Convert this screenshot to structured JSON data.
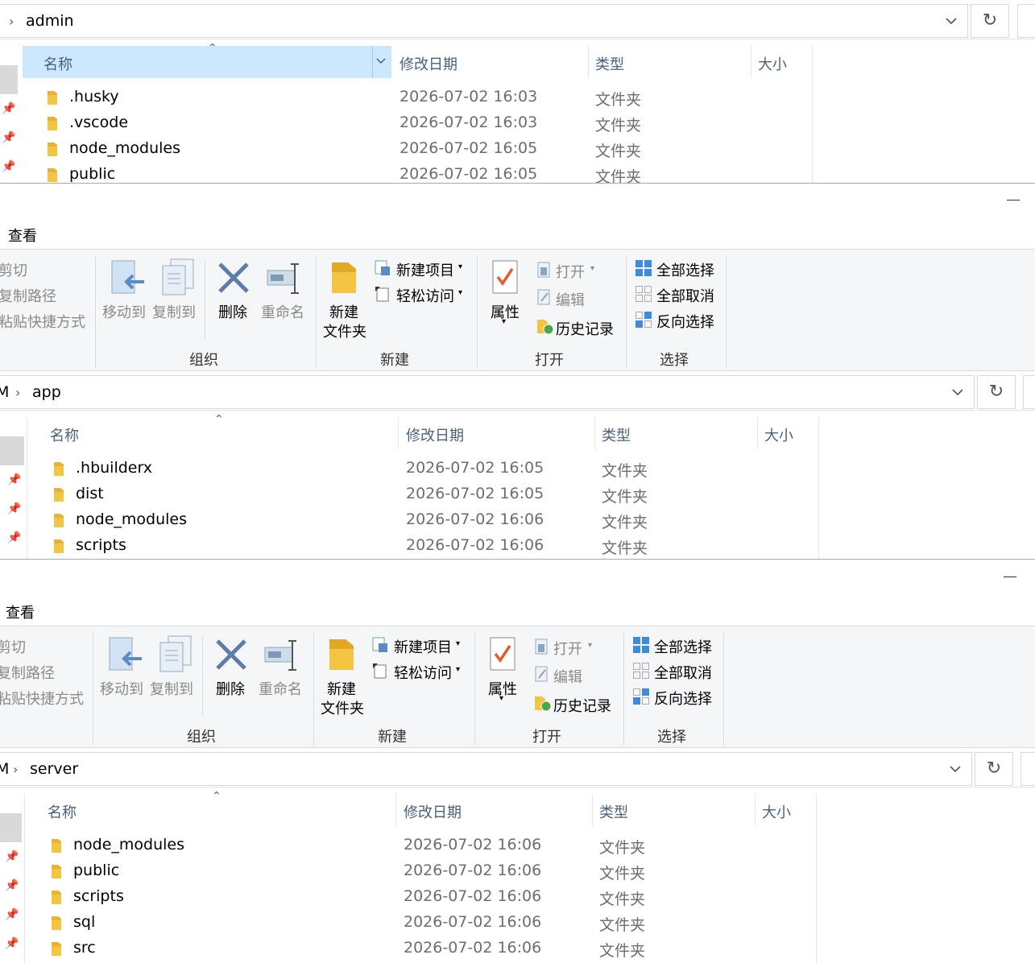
{
  "windows": [
    {
      "path_label": "admin",
      "columns": {
        "name": "名称",
        "modified": "修改日期",
        "type": "类型",
        "size": "大小"
      },
      "rows": [
        {
          "name": ".husky",
          "modified": "2026-07-02 16:03",
          "type": "文件夹"
        },
        {
          "name": ".vscode",
          "modified": "2026-07-02 16:03",
          "type": "文件夹"
        },
        {
          "name": "node_modules",
          "modified": "2026-07-02 16:05",
          "type": "文件夹"
        },
        {
          "name": "public",
          "modified": "2026-07-02 16:05",
          "type": "文件夹"
        }
      ]
    },
    {
      "path_prefix": "M",
      "path_label": "app",
      "columns": {
        "name": "名称",
        "modified": "修改日期",
        "type": "类型",
        "size": "大小"
      },
      "rows": [
        {
          "name": ".hbuilderx",
          "modified": "2026-07-02 16:05",
          "type": "文件夹"
        },
        {
          "name": "dist",
          "modified": "2026-07-02 16:05",
          "type": "文件夹"
        },
        {
          "name": "node_modules",
          "modified": "2026-07-02 16:06",
          "type": "文件夹"
        },
        {
          "name": "scripts",
          "modified": "2026-07-02 16:06",
          "type": "文件夹"
        }
      ]
    },
    {
      "path_prefix": "M",
      "path_label": "server",
      "columns": {
        "name": "名称",
        "modified": "修改日期",
        "type": "类型",
        "size": "大小"
      },
      "rows": [
        {
          "name": "node_modules",
          "modified": "2026-07-02 16:06",
          "type": "文件夹"
        },
        {
          "name": "public",
          "modified": "2026-07-02 16:06",
          "type": "文件夹"
        },
        {
          "name": "scripts",
          "modified": "2026-07-02 16:06",
          "type": "文件夹"
        },
        {
          "name": "sql",
          "modified": "2026-07-02 16:06",
          "type": "文件夹"
        },
        {
          "name": "src",
          "modified": "2026-07-02 16:06",
          "type": "文件夹"
        }
      ]
    }
  ],
  "ribbon": {
    "tab_view": "查看",
    "clipboard": {
      "cut": "剪切",
      "copy_path": "复制路径",
      "paste_shortcut": "粘贴快捷方式"
    },
    "organize": {
      "move_to": "移动到",
      "copy_to": "复制到",
      "delete": "删除",
      "rename": "重命名",
      "group": "组织"
    },
    "new": {
      "new_folder_line1": "新建",
      "new_folder_line2": "文件夹",
      "new_item": "新建项目",
      "easy_access": "轻松访问",
      "group": "新建"
    },
    "open": {
      "properties": "属性",
      "open": "打开",
      "edit": "编辑",
      "history": "历史记录",
      "group": "打开"
    },
    "select": {
      "select_all": "全部选择",
      "select_none": "全部取消",
      "invert": "反向选择",
      "group": "选择"
    }
  },
  "colors": {
    "selected_header": "#cce8ff",
    "ribbon_bg": "#f5f6f7",
    "folder": "#f4c542",
    "header_text": "#4c607a",
    "meta_text": "#6d6d6d"
  }
}
